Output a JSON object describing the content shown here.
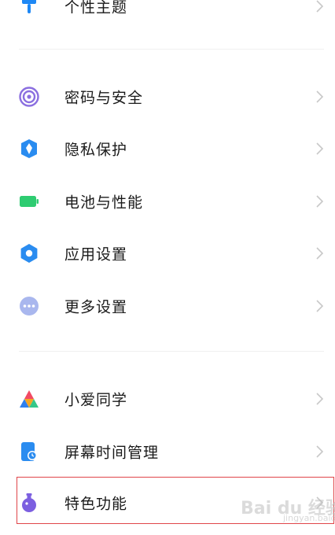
{
  "settings": {
    "items": [
      {
        "label": "个性主题",
        "icon": "theme-icon"
      },
      {
        "label": "密码与安全",
        "icon": "fingerprint-icon"
      },
      {
        "label": "隐私保护",
        "icon": "privacy-shield-icon"
      },
      {
        "label": "电池与性能",
        "icon": "battery-icon"
      },
      {
        "label": "应用设置",
        "icon": "gear-icon"
      },
      {
        "label": "更多设置",
        "icon": "more-dots-icon"
      },
      {
        "label": "小爱同学",
        "icon": "xiaoai-icon"
      },
      {
        "label": "屏幕时间管理",
        "icon": "screen-time-icon"
      },
      {
        "label": "特色功能",
        "icon": "flask-icon"
      }
    ]
  },
  "watermark": {
    "text": "Bai du 经验",
    "sub": "jingyan.baidu.com"
  },
  "colors": {
    "theme_icon": "#1e88f5",
    "fingerprint_icon": "#8b6fe0",
    "privacy_icon": "#2a8cf0",
    "battery_icon": "#2ecc71",
    "gear_icon": "#2a8cf0",
    "more_icon": "#a9b7ee",
    "screen_time_icon": "#2a8cf0",
    "flask_icon": "#7c5fe0",
    "highlight_border": "#e0454a"
  }
}
